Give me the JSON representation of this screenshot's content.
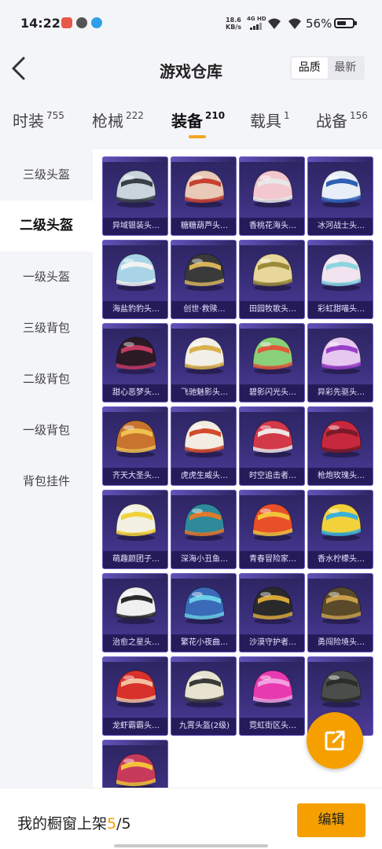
{
  "status_bar": {
    "time": "14:22",
    "net_speed_value": "18.6",
    "net_speed_unit": "KB/s",
    "network_type": "4G HD",
    "battery_percent": "56%"
  },
  "header": {
    "title": "游戏仓库",
    "sort_options": [
      "品质",
      "最新"
    ],
    "sort_selected": "品质"
  },
  "tabs": [
    {
      "label": "时装",
      "count": "755"
    },
    {
      "label": "枪械",
      "count": "222"
    },
    {
      "label": "装备",
      "count": "210",
      "active": true
    },
    {
      "label": "载具",
      "count": "1"
    },
    {
      "label": "战备",
      "count": "156"
    }
  ],
  "sidebar": {
    "items": [
      "三级头盔",
      "二级头盔",
      "一级头盔",
      "三级背包",
      "二级背包",
      "一级背包",
      "背包挂件"
    ],
    "selected": "二级头盔"
  },
  "items": [
    {
      "name": "异域银装头…",
      "color": "#c9d4dc",
      "accent": "#3a3f46"
    },
    {
      "name": "糖糖葫芦头…",
      "color": "#e9c9b8",
      "accent": "#c8402e"
    },
    {
      "name": "香桃花海头…",
      "color": "#f3c7d0",
      "accent": "#e8e8e8"
    },
    {
      "name": "冰河战士头…",
      "color": "#e8eef8",
      "accent": "#2f5fb5"
    },
    {
      "name": "海盐豹豹头…",
      "color": "#a9d3e6",
      "accent": "#f2f2f2"
    },
    {
      "name": "创世·救赎…",
      "color": "#3a3a3a",
      "accent": "#d6b35a"
    },
    {
      "name": "田园牧歌头…",
      "color": "#e7d79a",
      "accent": "#9a8a3a"
    },
    {
      "name": "彩虹甜喵头…",
      "color": "#f1e3ef",
      "accent": "#8ad5e0"
    },
    {
      "name": "甜心恶梦头…",
      "color": "#2b1a24",
      "accent": "#c23a62"
    },
    {
      "name": "飞驰魅影头…",
      "color": "#f1efe8",
      "accent": "#d9b04c"
    },
    {
      "name": "碧影闪光头…",
      "color": "#8ad07a",
      "accent": "#e05a3a"
    },
    {
      "name": "异彩先驱头…",
      "color": "#e6c7f0",
      "accent": "#9a3fc8"
    },
    {
      "name": "齐天大圣头…",
      "color": "#c8742e",
      "accent": "#f0c050"
    },
    {
      "name": "虎虎生威头…",
      "color": "#f3ece2",
      "accent": "#d24a2a"
    },
    {
      "name": "时空追击者…",
      "color": "#d23a4a",
      "accent": "#f0e6e6"
    },
    {
      "name": "枪炮玫瑰头…",
      "color": "#c8283e",
      "accent": "#7a1a28"
    },
    {
      "name": "萌趣颜团子…",
      "color": "#f3f1e2",
      "accent": "#f2d23a"
    },
    {
      "name": "深海小丑鱼…",
      "color": "#2e8a9a",
      "accent": "#e07a2a"
    },
    {
      "name": "青春冒险家…",
      "color": "#e8502a",
      "accent": "#f2c23a"
    },
    {
      "name": "香水柠檬头…",
      "color": "#f2d23a",
      "accent": "#3ab0d8"
    },
    {
      "name": "治愈之星头…",
      "color": "#f0f0f0",
      "accent": "#2a2a2a"
    },
    {
      "name": "繁花小夜曲…",
      "color": "#3a6ab8",
      "accent": "#6ad0e8"
    },
    {
      "name": "沙漠守护者…",
      "color": "#2a2a2a",
      "accent": "#d8a83a"
    },
    {
      "name": "勇闯险境头…",
      "color": "#5a4a2a",
      "accent": "#c8a04a"
    },
    {
      "name": "龙虾霸霸头…",
      "color": "#d8302a",
      "accent": "#f2c0a0"
    },
    {
      "name": "九霄头盔(2级)",
      "color": "#e8e2d0",
      "accent": "#3a3a3a"
    },
    {
      "name": "霓虹街区头…",
      "color": "#e83ab0",
      "accent": "#f0a0e0"
    },
    {
      "name": "",
      "color": "#4a4e4a",
      "accent": "#2a2e2a"
    },
    {
      "name": "",
      "color": "#c83a5a",
      "accent": "#f2c23a"
    }
  ],
  "showcase": {
    "label": "我的橱窗上架",
    "current": "5",
    "separator": "/",
    "max": "5",
    "edit_label": "编辑"
  },
  "colors": {
    "accent": "#f5a000",
    "card_bg": "#3a2f7c"
  }
}
